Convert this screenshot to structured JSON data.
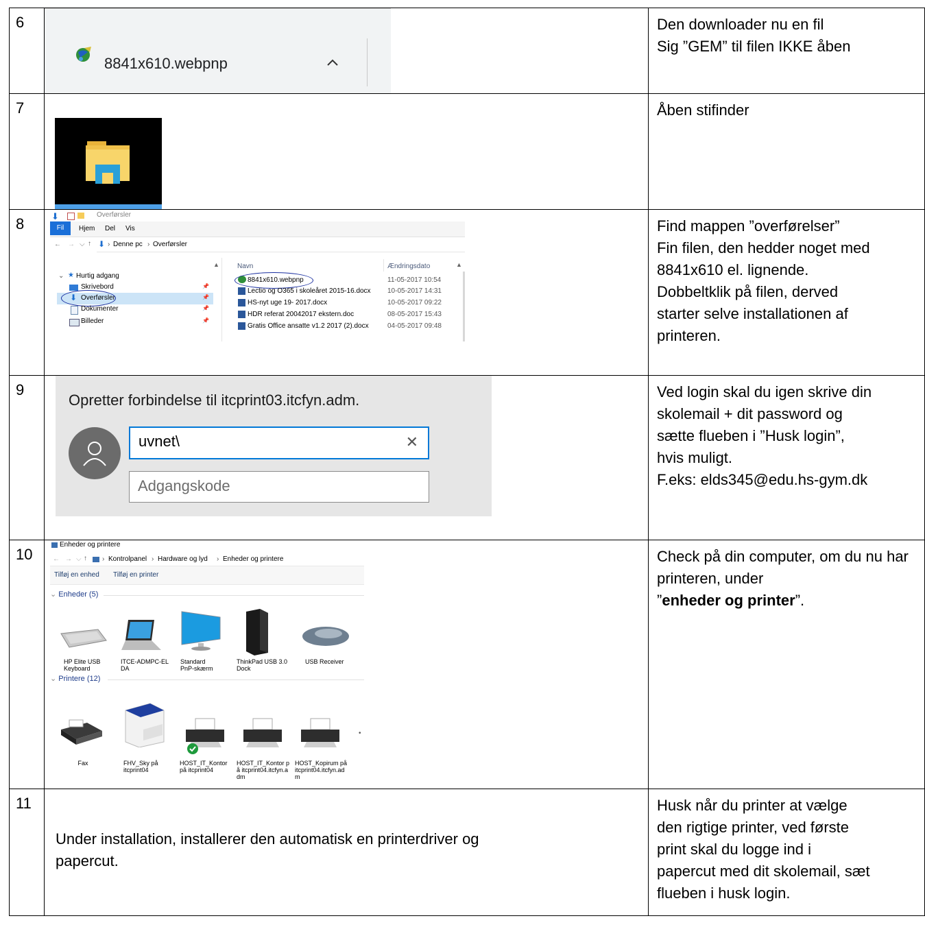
{
  "rows": [
    {
      "num": "6",
      "desc": [
        "Den downloader nu en fil",
        "Sig ”GEM” til filen IKKE åben"
      ],
      "download_bar": {
        "filename": "8841x610.webpnp"
      }
    },
    {
      "num": "7",
      "desc": [
        "Åben stifinder"
      ]
    },
    {
      "num": "8",
      "desc": [
        "Find mappen ”overførelser”",
        "Fin filen, den hedder noget med",
        "8841x610 el. lignende.",
        "Dobbeltklik på filen, derved",
        "starter selve installationen af",
        "printeren."
      ],
      "explorer": {
        "title": "Overførsler",
        "ribbon_tabs": [
          "Fil",
          "Hjem",
          "Del",
          "Vis"
        ],
        "breadcrumb": [
          "Denne pc",
          "Overførsler"
        ],
        "nav_header": "Hurtig adgang",
        "nav_items": [
          "Skrivebord",
          "Overførsler",
          "Dokumenter",
          "Billeder"
        ],
        "col_name": "Navn",
        "col_date": "Ændringsdato",
        "files": [
          {
            "name": "8841x610.webpnp",
            "date": "11-05-2017 10:54"
          },
          {
            "name": "Lectio og O365 i skoleåret 2015-16.docx",
            "date": "10-05-2017 14:31"
          },
          {
            "name": "HS-nyt uge 19- 2017.docx",
            "date": "10-05-2017 09:22"
          },
          {
            "name": "HDR referat 20042017 ekstern.doc",
            "date": "08-05-2017 15:43"
          },
          {
            "name": "Gratis Office ansatte v1.2 2017 (2).docx",
            "date": "04-05-2017 09:48"
          }
        ]
      }
    },
    {
      "num": "9",
      "desc": [
        "Ved login skal du igen skrive din",
        "skolemail + dit password og",
        "sætte flueben i ”Husk login”,",
        "hvis muligt.",
        "F.eks: elds345@edu.hs-gym.dk"
      ],
      "login": {
        "heading": "Opretter forbindelse til itcprint03.itcfyn.adm.",
        "username_value": "uvnet\\",
        "password_placeholder": "Adgangskode"
      }
    },
    {
      "num": "10",
      "desc_before": "Check på din computer, om du nu har printeren, under",
      "desc_quote_open": "”",
      "desc_bold": "enheder og printer",
      "desc_after": "”.",
      "devices": {
        "title": "Enheder og printere",
        "breadcrumb": [
          "Kontrolpanel",
          "Hardware og lyd",
          "Enheder og printere"
        ],
        "toolbar": [
          "Tilføj en enhed",
          "Tilføj en printer"
        ],
        "group_devices": "Enheder (5)",
        "devices": [
          "HP Elite USB Keyboard",
          "ITCE-ADMPC-ELDA",
          "Standard PnP-skærm",
          "ThinkPad USB 3.0 Dock",
          "USB Receiver"
        ],
        "group_printers": "Printere (12)",
        "printers": [
          "Fax",
          "FHV_Sky på itcprint04",
          "HOST_IT_Kontor på itcprint04",
          "HOST_IT_Kontor på itcprint04.itcfyn.adm",
          "HOST_Kopirum på itcprint04.itcfyn.adm"
        ]
      }
    },
    {
      "num": "11",
      "shot_text": [
        "Under installation, installerer den automatisk en printerdriver og",
        "papercut."
      ],
      "desc": [
        "Husk når du printer at vælge",
        "den rigtige printer, ved første",
        "print skal du logge ind i",
        "papercut med dit skolemail, sæt",
        "flueben i husk login."
      ]
    }
  ]
}
